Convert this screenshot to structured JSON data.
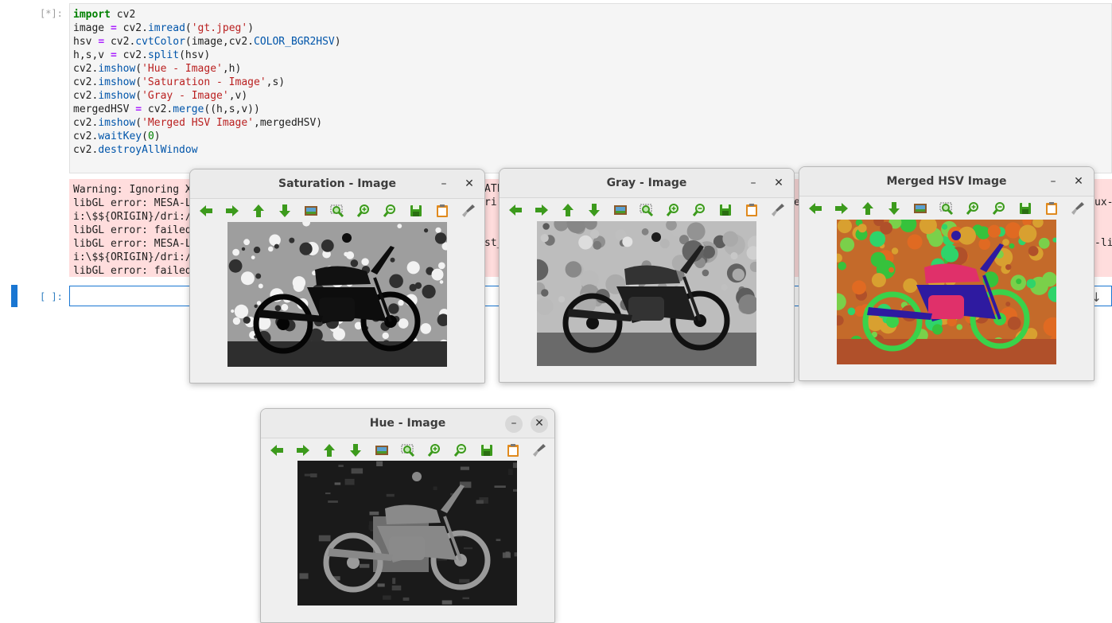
{
  "notebook": {
    "cell1_prompt": "[*]:",
    "cell2_prompt": "[ ]:",
    "code": [
      [
        {
          "t": "import",
          "c": "kw"
        },
        {
          "t": " cv2",
          "c": ""
        }
      ],
      [
        {
          "t": "image ",
          "c": ""
        },
        {
          "t": "=",
          "c": "op"
        },
        {
          "t": " cv2.",
          "c": ""
        },
        {
          "t": "imread",
          "c": "fn"
        },
        {
          "t": "(",
          "c": ""
        },
        {
          "t": "'gt.jpeg'",
          "c": "str"
        },
        {
          "t": ")",
          "c": ""
        }
      ],
      [
        {
          "t": "hsv ",
          "c": ""
        },
        {
          "t": "=",
          "c": "op"
        },
        {
          "t": " cv2.",
          "c": ""
        },
        {
          "t": "cvtColor",
          "c": "fn"
        },
        {
          "t": "(image,cv2.",
          "c": ""
        },
        {
          "t": "COLOR_BGR2HSV",
          "c": "fn"
        },
        {
          "t": ")",
          "c": ""
        }
      ],
      [
        {
          "t": "h,s,v ",
          "c": ""
        },
        {
          "t": "=",
          "c": "op"
        },
        {
          "t": " cv2.",
          "c": ""
        },
        {
          "t": "split",
          "c": "fn"
        },
        {
          "t": "(hsv)",
          "c": ""
        }
      ],
      [
        {
          "t": "cv2.",
          "c": ""
        },
        {
          "t": "imshow",
          "c": "fn"
        },
        {
          "t": "(",
          "c": ""
        },
        {
          "t": "'Hue - Image'",
          "c": "str"
        },
        {
          "t": ",h)",
          "c": ""
        }
      ],
      [
        {
          "t": "cv2.",
          "c": ""
        },
        {
          "t": "imshow",
          "c": "fn"
        },
        {
          "t": "(",
          "c": ""
        },
        {
          "t": "'Saturation - Image'",
          "c": "str"
        },
        {
          "t": ",s)",
          "c": ""
        }
      ],
      [
        {
          "t": "cv2.",
          "c": ""
        },
        {
          "t": "imshow",
          "c": "fn"
        },
        {
          "t": "(",
          "c": ""
        },
        {
          "t": "'Gray - Image'",
          "c": "str"
        },
        {
          "t": ",v)",
          "c": ""
        }
      ],
      [
        {
          "t": "mergedHSV ",
          "c": ""
        },
        {
          "t": "=",
          "c": "op"
        },
        {
          "t": " cv2.",
          "c": ""
        },
        {
          "t": "merge",
          "c": "fn"
        },
        {
          "t": "((h,s,v))",
          "c": ""
        }
      ],
      [
        {
          "t": "cv2.",
          "c": ""
        },
        {
          "t": "imshow",
          "c": "fn"
        },
        {
          "t": "(",
          "c": ""
        },
        {
          "t": "'Merged HSV Image'",
          "c": "str"
        },
        {
          "t": ",mergedHSV)",
          "c": ""
        }
      ],
      [
        {
          "t": "cv2.",
          "c": ""
        },
        {
          "t": "waitKey",
          "c": "fn"
        },
        {
          "t": "(",
          "c": ""
        },
        {
          "t": "0",
          "c": "num"
        },
        {
          "t": ")",
          "c": ""
        }
      ],
      [
        {
          "t": "cv2.",
          "c": ""
        },
        {
          "t": "destroyAllWindow",
          "c": "fn"
        }
      ]
    ],
    "stderr_left": [
      "Warning: Ignoring X",
      "libGL error: MESA-L",
      "i:\\$${ORIGIN}/dri:/",
      "libGL error: failed",
      "libGL error: MESA-L",
      "i:\\$${ORIGIN}/dri:/",
      "libGL error: failed"
    ],
    "stderr_fragments": [
      "ATF",
      "ri.",
      "st_",
      "e",
      "ux-",
      "-li"
    ]
  },
  "windows": [
    {
      "id": "saturation",
      "title": "Saturation - Image",
      "min_label": "–",
      "close_label": "✕",
      "mode": "sat"
    },
    {
      "id": "gray",
      "title": "Gray - Image",
      "min_label": "–",
      "close_label": "✕",
      "mode": "gray"
    },
    {
      "id": "merged",
      "title": "Merged HSV Image",
      "min_label": "–",
      "close_label": "✕",
      "mode": "merged"
    },
    {
      "id": "hue",
      "title": "Hue - Image",
      "min_label": "–",
      "close_label": "✕",
      "mode": "hue"
    }
  ],
  "toolbar_icons": [
    "pan-left-icon",
    "pan-right-icon",
    "pan-up-icon",
    "pan-down-icon",
    "zoom-fit-icon",
    "zoom-area-icon",
    "zoom-in-icon",
    "zoom-out-icon",
    "save-icon",
    "copy-icon",
    "properties-icon"
  ],
  "colors": {
    "toolbar_green": "#3c9a1c",
    "accent": "#1976d2",
    "stderr_bg": "#ffdddd"
  }
}
